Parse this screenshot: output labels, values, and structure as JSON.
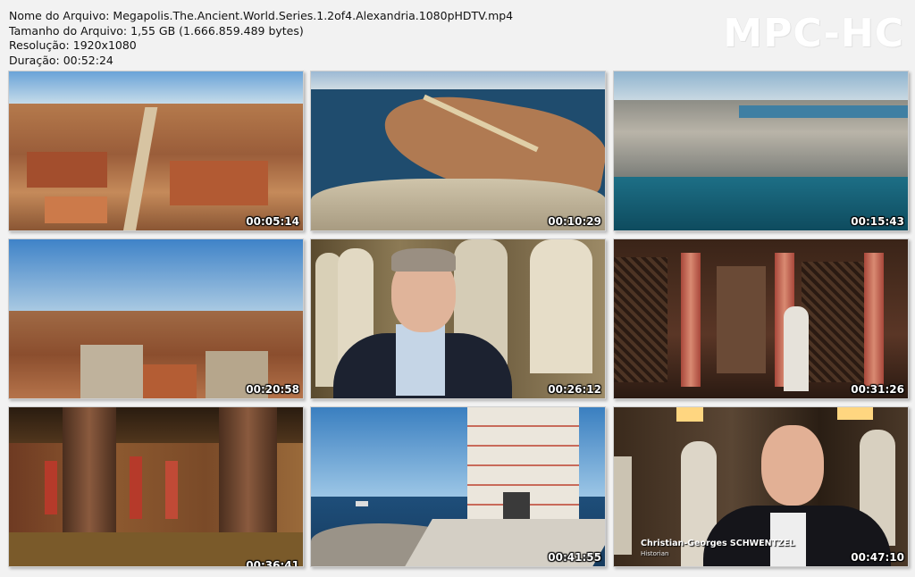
{
  "file_info": {
    "filename_line": "Nome do Arquivo: Megapolis.The.Ancient.World.Series.1.2of4.Alexandria.1080pHDTV.mp4",
    "size_line": "Tamanho do Arquivo: 1,55 GB (1.666.859.489 bytes)",
    "resolution_line": "Resolução: 1920x1080",
    "duration_line": "Duração: 00:52:24"
  },
  "logo": "MPC-HC",
  "thumbnails": [
    {
      "timestamp": "00:05:14",
      "scene": "aerial-ancient-city"
    },
    {
      "timestamp": "00:10:29",
      "scene": "aerial-peninsula-causeway"
    },
    {
      "timestamp": "00:15:43",
      "scene": "aerial-modern-coastline"
    },
    {
      "timestamp": "00:20:58",
      "scene": "city-rooftops-horizon"
    },
    {
      "timestamp": "00:26:12",
      "scene": "interview-man-glasses-statues"
    },
    {
      "timestamp": "00:31:26",
      "scene": "temple-interior-columns-statue"
    },
    {
      "timestamp": "00:36:41",
      "scene": "egyptian-hall-painted-columns"
    },
    {
      "timestamp": "00:41:55",
      "scene": "lighthouse-tower-sea"
    },
    {
      "timestamp": "00:47:10",
      "scene": "interview-man-statues-caption"
    }
  ],
  "caption": {
    "name": "Christian-Georges SCHWENTZEL",
    "title": "Historian"
  },
  "colors": {
    "background": "#f2f2f2",
    "timestamp_text": "#ffffff",
    "logo_text": "#ffffff"
  }
}
